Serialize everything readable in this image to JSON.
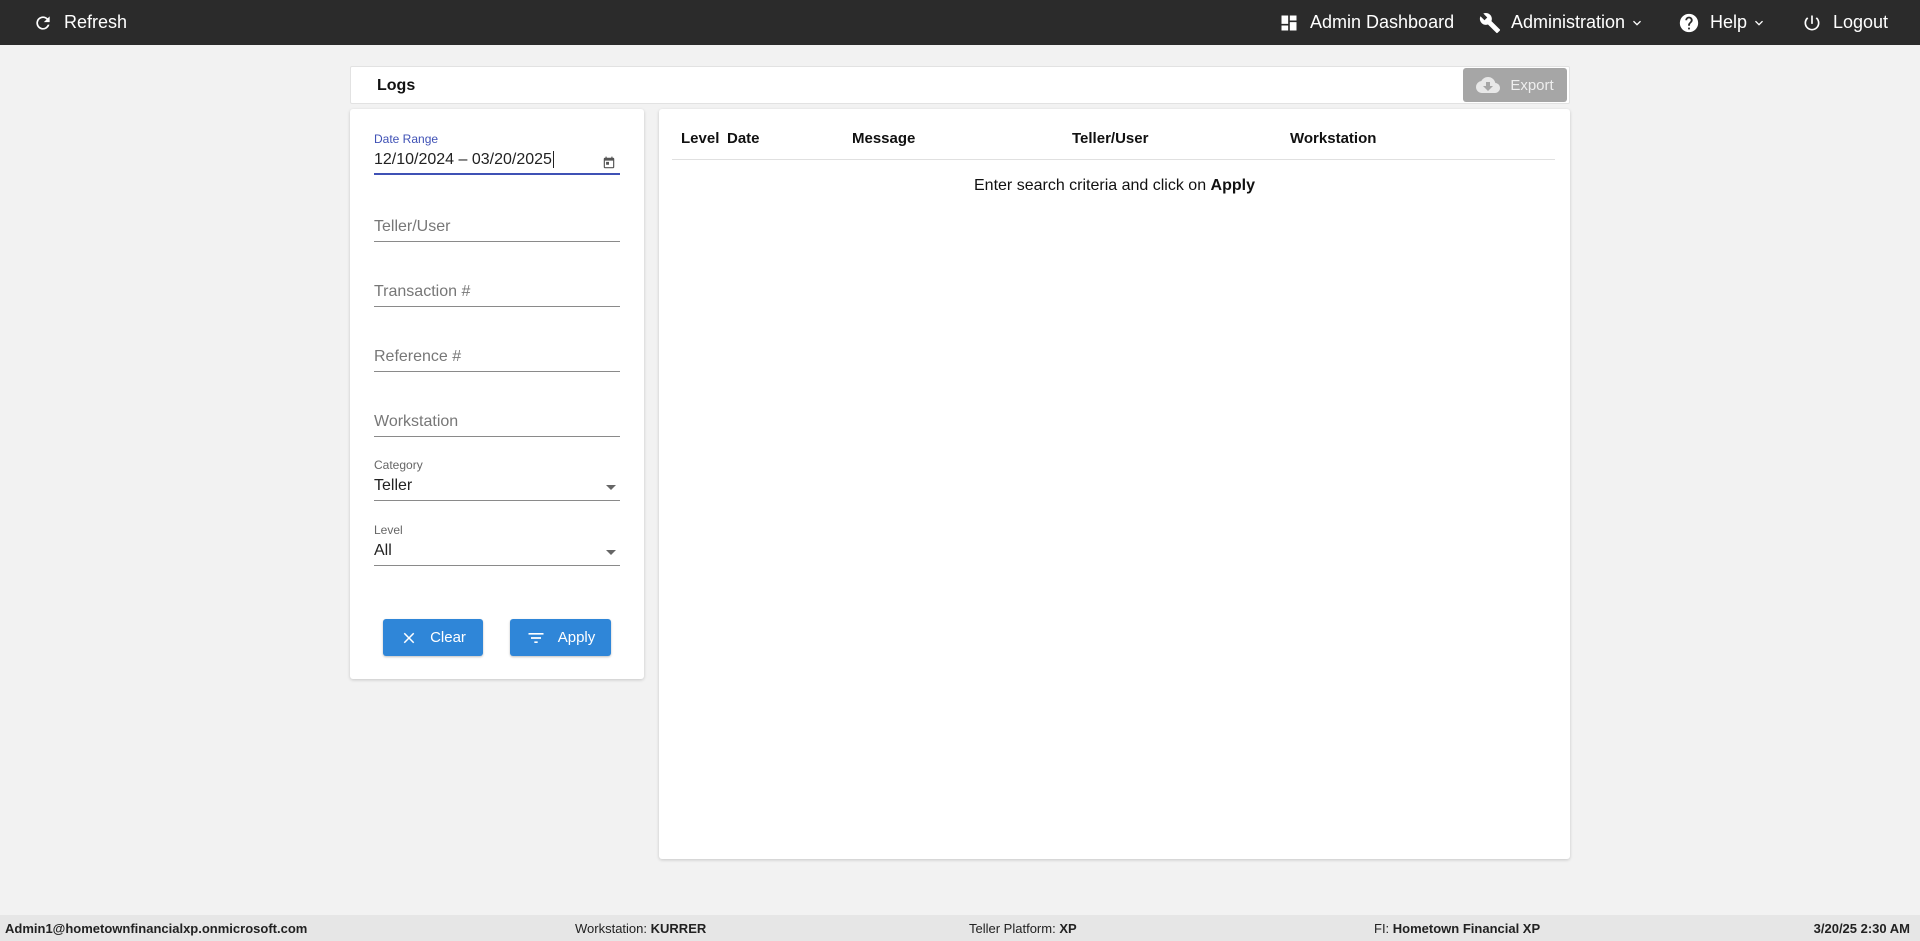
{
  "topbar": {
    "refresh_label": "Refresh",
    "admin_dashboard_label": "Admin Dashboard",
    "administration_label": "Administration",
    "help_label": "Help",
    "logout_label": "Logout"
  },
  "logs_header": {
    "title": "Logs",
    "export_label": "Export"
  },
  "filters": {
    "date_range": {
      "label": "Date Range",
      "value": "12/10/2024 – 03/20/2025"
    },
    "teller_user": {
      "placeholder": "Teller/User"
    },
    "transaction": {
      "placeholder": "Transaction #"
    },
    "reference": {
      "placeholder": "Reference #"
    },
    "workstation": {
      "placeholder": "Workstation"
    },
    "category": {
      "label": "Category",
      "value": "Teller"
    },
    "level": {
      "label": "Level",
      "value": "All"
    },
    "clear_label": "Clear",
    "apply_label": "Apply"
  },
  "results": {
    "columns": [
      "Level",
      "Date",
      "Message",
      "Teller/User",
      "Workstation"
    ],
    "empty_text": "Enter search criteria and click on ",
    "empty_bold": "Apply"
  },
  "footer": {
    "user": "Admin1@hometownfinancialxp.onmicrosoft.com",
    "workstation_label": "Workstation:",
    "workstation_value": "KURRER",
    "platform_label": "Teller Platform:",
    "platform_value": "XP",
    "fi_label": "FI:",
    "fi_value": "Hometown Financial XP",
    "datetime": "3/20/25 2:30 AM"
  },
  "colors": {
    "topbar_bg": "#2b2b2b",
    "primary_button": "#2f86d8",
    "focus_accent": "#3f51b5",
    "export_disabled": "#a6a6a6"
  },
  "icons": [
    "refresh-icon",
    "dashboard-icon",
    "wrench-icon",
    "help-circle-icon",
    "power-icon",
    "cloud-download-icon",
    "calendar-icon",
    "close-icon",
    "filter-icon",
    "chevron-down-icon",
    "dropdown-arrow-icon"
  ]
}
